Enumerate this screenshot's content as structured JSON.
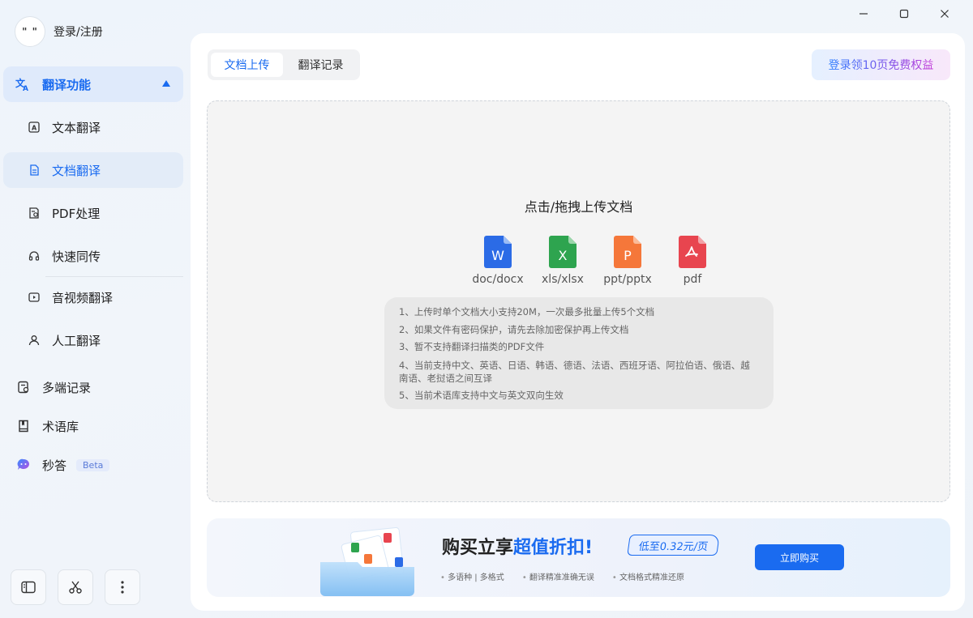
{
  "window": {
    "minimize": "minimize",
    "maximize": "maximize",
    "close": "close"
  },
  "user": {
    "avatar_text": "\" \"",
    "login_label": "登录/注册"
  },
  "sidebar": {
    "group": {
      "label": "翻译功能",
      "icon": "translate-icon",
      "expanded": true
    },
    "sub_items": [
      {
        "label": "文本翻译",
        "icon": "text-translate-icon",
        "active": false
      },
      {
        "label": "文档翻译",
        "icon": "document-icon",
        "active": true
      },
      {
        "label": "PDF处理",
        "icon": "pdf-icon",
        "active": false
      },
      {
        "label": "快速同传",
        "icon": "headset-icon",
        "active": false
      },
      {
        "label": "音视频翻译",
        "icon": "video-icon",
        "active": false
      },
      {
        "label": "人工翻译",
        "icon": "person-icon",
        "active": false
      }
    ],
    "items": [
      {
        "label": "多端记录",
        "icon": "record-icon"
      },
      {
        "label": "术语库",
        "icon": "book-icon"
      },
      {
        "label": "秒答",
        "icon": "ai-chat-icon",
        "badge": "Beta"
      }
    ]
  },
  "tabs": [
    {
      "label": "文档上传",
      "active": true
    },
    {
      "label": "翻译记录",
      "active": false
    }
  ],
  "promo_button": "登录领10页免费权益",
  "upload": {
    "title": "点击/拖拽上传文档",
    "formats": [
      {
        "label": "doc/docx",
        "letter": "W",
        "color": "#2b6be6"
      },
      {
        "label": "xls/xlsx",
        "letter": "X",
        "color": "#2ea44f"
      },
      {
        "label": "ppt/pptx",
        "letter": "P",
        "color": "#f5773a"
      },
      {
        "label": "pdf",
        "letter": "",
        "color": "#e8454f"
      }
    ],
    "notes": [
      "1、上传时单个文档大小支持20M，一次最多批量上传5个文档",
      "2、如果文件有密码保护，请先去除加密保护再上传文档",
      "3、暂不支持翻译扫描类的PDF文件",
      "4、当前支持中文、英语、日语、韩语、德语、法语、西班牙语、阿拉伯语、俄语、越南语、老挝语之间互译",
      "5、当前术语库支持中文与英文双向生效"
    ]
  },
  "banner": {
    "title_pre": "购买立享",
    "title_hl": "超值折扣",
    "title_post": "!",
    "price_tag": "低至0.32元/页",
    "features": [
      "多语种 | 多格式",
      "翻译精准准确无误",
      "文档格式精准还原"
    ],
    "buy_label": "立即购买"
  }
}
